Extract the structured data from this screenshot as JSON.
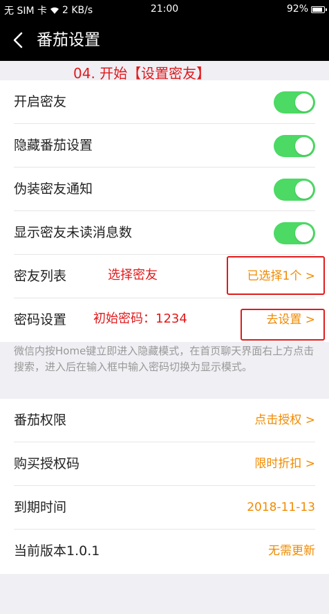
{
  "status_bar": {
    "carrier": "无 SIM 卡",
    "speed": "2 KB/s",
    "time": "21:00",
    "battery_percent": "92%",
    "battery_level": 0.92
  },
  "header": {
    "title": "番茄设置"
  },
  "step_annotation": "04. 开始【设置密友】",
  "settings": [
    {
      "label": "开启密友",
      "toggle": true
    },
    {
      "label": "隐藏番茄设置",
      "toggle": true
    },
    {
      "label": "伪装密友通知",
      "toggle": true
    },
    {
      "label": "显示密友未读消息数",
      "toggle": true
    }
  ],
  "friend_list": {
    "label": "密友列表",
    "annotation": "选择密友",
    "value": "已选择1个 >"
  },
  "password": {
    "label": "密码设置",
    "annotation": "初始密码：1234",
    "value": "去设置 >"
  },
  "note": "微信内按Home键立即进入隐藏模式，在首页聊天界面右上方点击搜索，进入后在输入框中输入密码切换为显示模式。",
  "info_rows": [
    {
      "label": "番茄权限",
      "value": "点击授权 >"
    },
    {
      "label": "购买授权码",
      "value": "限时折扣 >"
    },
    {
      "label": "到期时间",
      "value": "2018-11-13"
    },
    {
      "label": "当前版本1.0.1",
      "value": "无需更新"
    }
  ],
  "colors": {
    "accent_orange": "#f08a00",
    "toggle_green": "#4cd964",
    "annotation_red": "#e0191b"
  }
}
